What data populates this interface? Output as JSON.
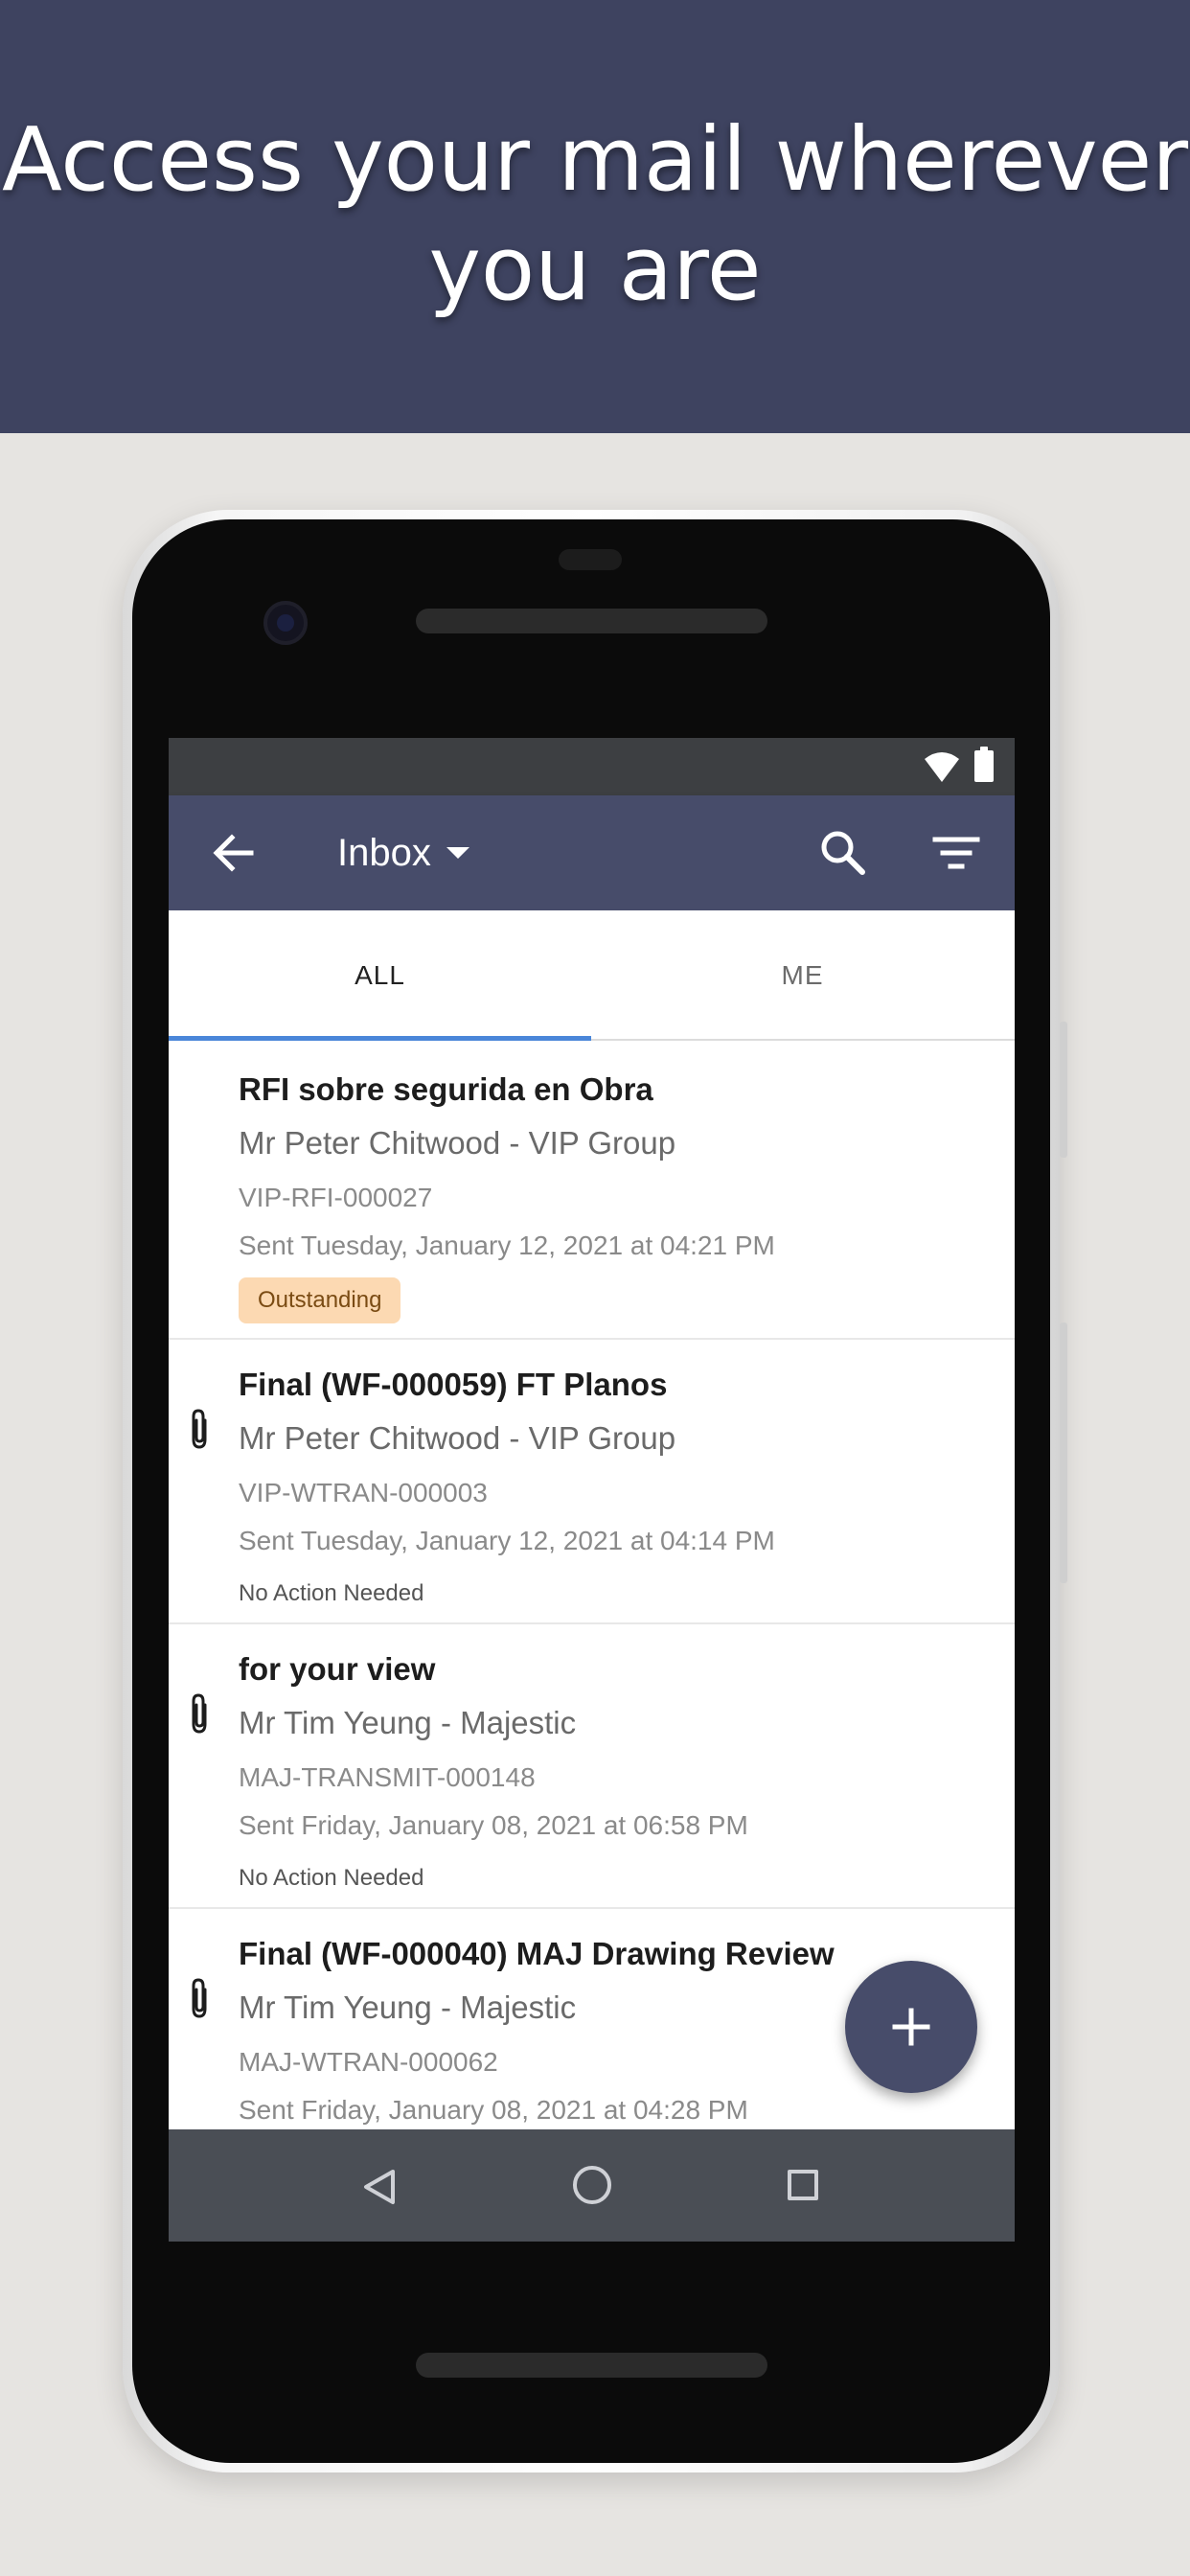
{
  "banner": {
    "title_line1": "Access your mail wherever",
    "title_line2": "you are"
  },
  "appbar": {
    "title": "Inbox",
    "back_icon": "arrow-left-icon",
    "search_icon": "search-icon",
    "filter_icon": "filter-icon"
  },
  "tabs": [
    {
      "label": "ALL",
      "selected": true
    },
    {
      "label": "ME",
      "selected": false
    }
  ],
  "messages": [
    {
      "subject": "RFI sobre segurida en Obra",
      "sender": "Mr Peter Chitwood - VIP Group",
      "reference": "VIP-RFI-000027",
      "sent": "Sent Tuesday, January 12, 2021 at 04:21 PM",
      "status": "Outstanding",
      "has_attachment": false
    },
    {
      "subject": "Final (WF-000059) FT Planos",
      "sender": "Mr Peter Chitwood - VIP Group",
      "reference": "VIP-WTRAN-000003",
      "sent": "Sent Tuesday, January 12, 2021 at 04:14 PM",
      "status": "No Action Needed",
      "has_attachment": true
    },
    {
      "subject": "for your view",
      "sender": "Mr Tim Yeung - Majestic",
      "reference": "MAJ-TRANSMIT-000148",
      "sent": "Sent Friday, January 08, 2021 at 06:58 PM",
      "status": "No Action Needed",
      "has_attachment": true
    },
    {
      "subject": "Final (WF-000040) MAJ Drawing Review",
      "sender": "Mr Tim Yeung - Majestic",
      "reference": "MAJ-WTRAN-000062",
      "sent": "Sent Friday, January 08, 2021 at 04:28 PM",
      "has_attachment": true
    }
  ],
  "colors": {
    "banner": "#3e4360",
    "appbar": "#474c6a",
    "tab_indicator": "#4a86d9",
    "badge_bg": "#fcd9b2",
    "badge_text": "#7a4b13"
  },
  "fab": {
    "icon": "plus-icon"
  }
}
